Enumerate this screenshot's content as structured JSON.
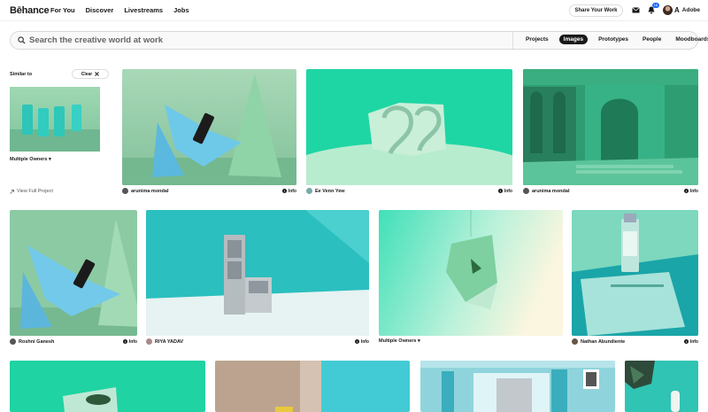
{
  "header": {
    "logo": "Bēhance",
    "nav": [
      "For You",
      "Discover",
      "Livestreams",
      "Jobs"
    ],
    "share_label": "Share Your Work",
    "notification_count": "16",
    "adobe_label": "Adobe",
    "adobe_glyph": "A"
  },
  "search": {
    "placeholder": "Search the creative world at work",
    "filters": [
      "Projects",
      "Images",
      "Prototypes",
      "People",
      "Moodboards"
    ],
    "active_filter": "Images"
  },
  "sidebar": {
    "similar_label": "Similar to",
    "clear_label": "Clear",
    "owners_label": "Multiple Owners ▾",
    "view_full_label": "View Full Project"
  },
  "cards": [
    {
      "owner": "arunima mondal",
      "info": "Info"
    },
    {
      "owner": "Ee Venn Yew",
      "info": "Info"
    },
    {
      "owner": "arunima mondal",
      "info": "Info"
    },
    {
      "owner": "Roshni Ganesh",
      "info": "Info"
    },
    {
      "owner": "RIYA YADAV",
      "info": "Info"
    },
    {
      "owner": "Multiple Owners ▾",
      "info": ""
    },
    {
      "owner": "Nathan Abundiente",
      "info": "Info"
    }
  ],
  "colors": {
    "accent": "#1769ff",
    "mint": "#1ed6a4",
    "teal": "#2bbfbf"
  }
}
